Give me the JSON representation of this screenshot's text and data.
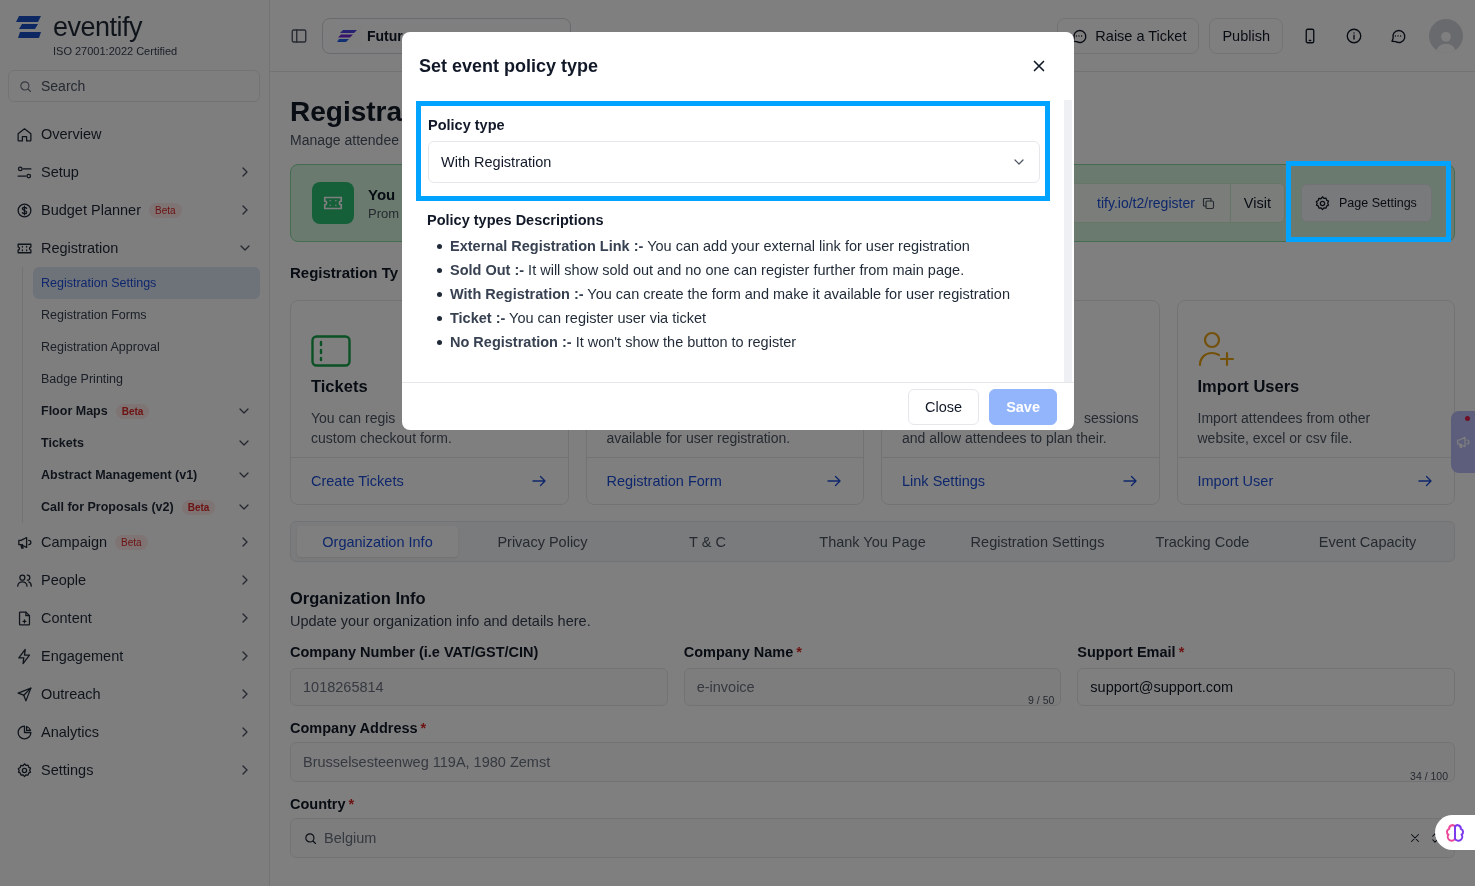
{
  "sidebar": {
    "logo": "eventify",
    "certification": "ISO 27001:2022 Certified",
    "search": {
      "placeholder": "Search"
    },
    "items": [
      {
        "label": "Overview"
      },
      {
        "label": "Setup",
        "expanded": false
      },
      {
        "label": "Budget Planner",
        "badge": "Beta",
        "expanded": false
      },
      {
        "label": "Registration",
        "expanded": true,
        "children": [
          {
            "label": "Registration Settings",
            "selected": true
          },
          {
            "label": "Registration Forms",
            "selected": false
          },
          {
            "label": "Registration Approval",
            "selected": false
          },
          {
            "label": "Badge Printing",
            "selected": false
          },
          {
            "label": "Floor Maps",
            "badge": "Beta",
            "selected": false,
            "submenu": true
          },
          {
            "label": "Tickets",
            "selected": false,
            "submenu": true
          },
          {
            "label": "Abstract Management (v1)",
            "selected": false,
            "submenu": true
          },
          {
            "label": "Call for Proposals (v2)",
            "badge": "Beta",
            "selected": false,
            "submenu": true
          }
        ]
      },
      {
        "label": "Campaign",
        "badge": "Beta",
        "expanded": false
      },
      {
        "label": "People",
        "expanded": false
      },
      {
        "label": "Content",
        "expanded": false
      },
      {
        "label": "Engagement",
        "expanded": false
      },
      {
        "label": "Outreach",
        "expanded": false
      },
      {
        "label": "Analytics",
        "expanded": false
      },
      {
        "label": "Settings",
        "expanded": false
      }
    ]
  },
  "top_bar": {
    "event_selector": "Futur",
    "buttons": [
      {
        "kind": "ticket",
        "label": "Raise a Ticket"
      },
      {
        "kind": "plain",
        "label": "Publish"
      }
    ]
  },
  "page": {
    "title": "Registra",
    "subtitle": "Manage attendee"
  },
  "banner": {
    "title": "You",
    "subtitle": "Prom",
    "link": "tify.io/t2/register",
    "visit": "Visit",
    "settings": "Page Settings"
  },
  "section_title": "Registration Ty",
  "cards": [
    {
      "kind": "tickets",
      "title": "Tickets",
      "lines": [
        {
          "text": "You can regis"
        },
        {
          "text": "custom checkout form."
        }
      ],
      "action": "Create Tickets"
    },
    {
      "lines": [
        {
          "text": "available for user registration."
        }
      ],
      "action": "Registration Form"
    },
    {
      "lines": [
        {
          "text": "sessions",
          "clipped": true
        },
        {
          "text": "and allow attendees to plan their."
        }
      ],
      "action": "Link Settings"
    },
    {
      "kind": "import",
      "title": "Import Users",
      "lines": [
        {
          "text": "Import attendees from other"
        },
        {
          "text": "website, excel or csv file."
        }
      ],
      "action": "Import User"
    }
  ],
  "tabs": [
    {
      "label": "Organization Info",
      "selected": true
    },
    {
      "label": "Privacy Policy",
      "selected": false
    },
    {
      "label": "T & C",
      "selected": false
    },
    {
      "label": "Thank You Page",
      "selected": false
    },
    {
      "label": "Registration Settings",
      "selected": false
    },
    {
      "label": "Tracking Code",
      "selected": false
    },
    {
      "label": "Event Capacity",
      "selected": false
    }
  ],
  "org_info": {
    "title": "Organization Info",
    "subtitle": "Update your organization info and details here.",
    "fields": [
      {
        "kind": "text",
        "label": "Company Number (i.e VAT/GST/CIN)",
        "value": "1018265814",
        "disabled": true
      },
      {
        "kind": "text",
        "label": "Company Name",
        "required_mark": "*",
        "value": "e-invoice",
        "disabled": true,
        "counter": "9 / 50"
      },
      {
        "kind": "text",
        "label": "Support Email",
        "required_mark": "*",
        "value": "support@support.com",
        "disabled": false
      },
      {
        "kind": "text",
        "label": "Company Address",
        "required_mark": "*",
        "value": "Brusselsesteenweg 119A, 1980 Zemst",
        "disabled": true,
        "counter": "34 / 100"
      },
      {
        "kind": "search",
        "label": "Country",
        "required_mark": "*",
        "value": "Belgium",
        "disabled": true
      }
    ]
  },
  "modal": {
    "title": "Set event policy type",
    "policy_label": "Policy type",
    "policy_value": "With Registration",
    "descriptions_title": "Policy types Descriptions",
    "descriptions": [
      "**External Registration Link :-** You can add your external link for user registration",
      "**Sold Out :-** It will show sold out and no one can register further from main page.",
      "**With Registration :-** You can create the form and make it available for user registration",
      "**Ticket :-** You can register user via ticket",
      "**No Registration :-** It won't show the button to register"
    ],
    "buttons": [
      {
        "kind": "secondary",
        "label": "Close"
      },
      {
        "kind": "primary",
        "label": "Save",
        "disabled": true
      }
    ]
  }
}
